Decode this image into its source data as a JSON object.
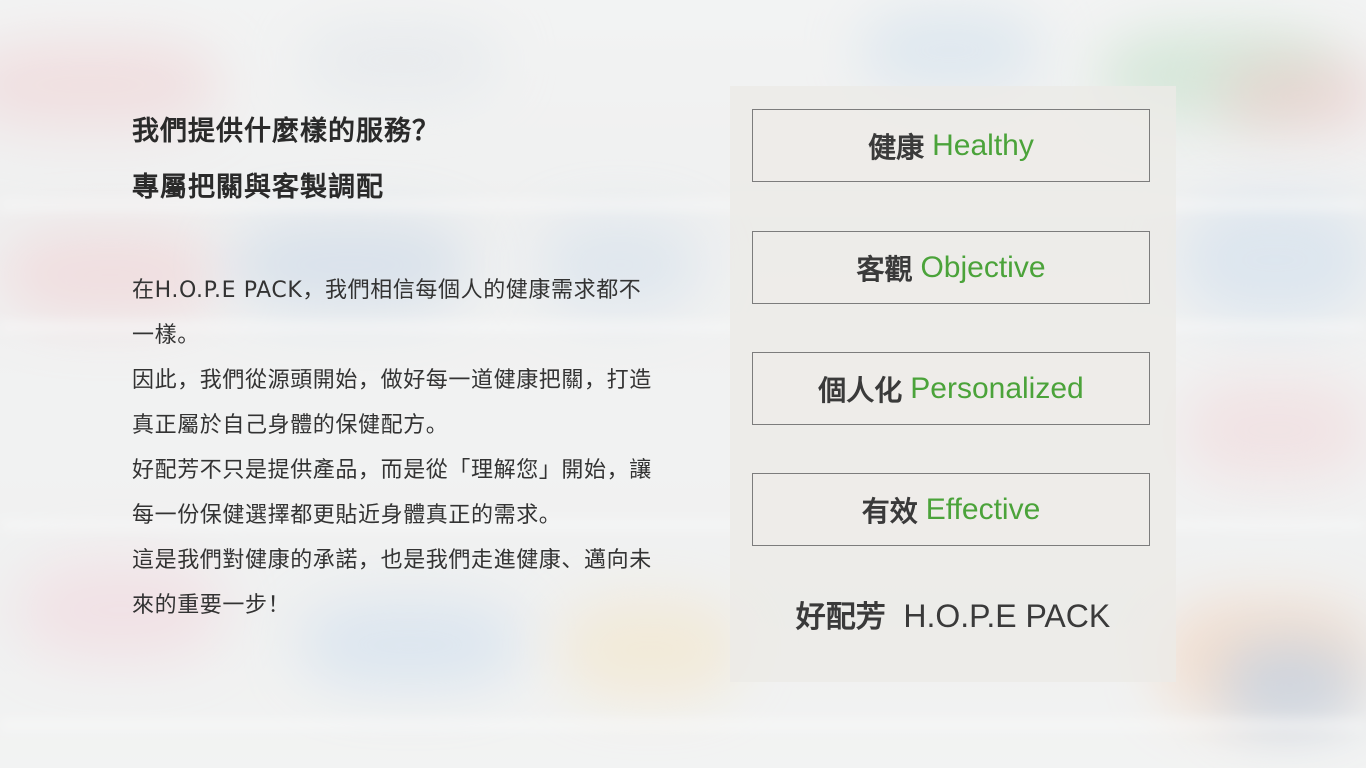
{
  "heading": {
    "line1": "我們提供什麼樣的服務？",
    "line2": "專屬把關與客製調配"
  },
  "body": {
    "paragraphs": [
      "在H.O.P.E PACK，我們相信每個人的健康需求都不一樣。",
      "因此，我們從源頭開始，做好每一道健康把關，打造真正屬於自己身體的保健配方。",
      "好配芳不只是提供產品，而是從「理解您」開始，讓每一份保健選擇都更貼近身體真正的需求。",
      "這是我們對健康的承諾，也是我們走進健康、邁向未來的重要一步！"
    ]
  },
  "values": [
    {
      "zh": "健康",
      "en": "Healthy"
    },
    {
      "zh": "客觀",
      "en": "Objective"
    },
    {
      "zh": "個人化",
      "en": "Personalized"
    },
    {
      "zh": "有效",
      "en": "Effective"
    }
  ],
  "brand": {
    "zh": "好配芳",
    "en": "H.O.P.E PACK"
  },
  "colors": {
    "accent_green": "#4ba33a",
    "text_dark": "#2a2a2a",
    "panel_bg": "#ecebe6"
  }
}
